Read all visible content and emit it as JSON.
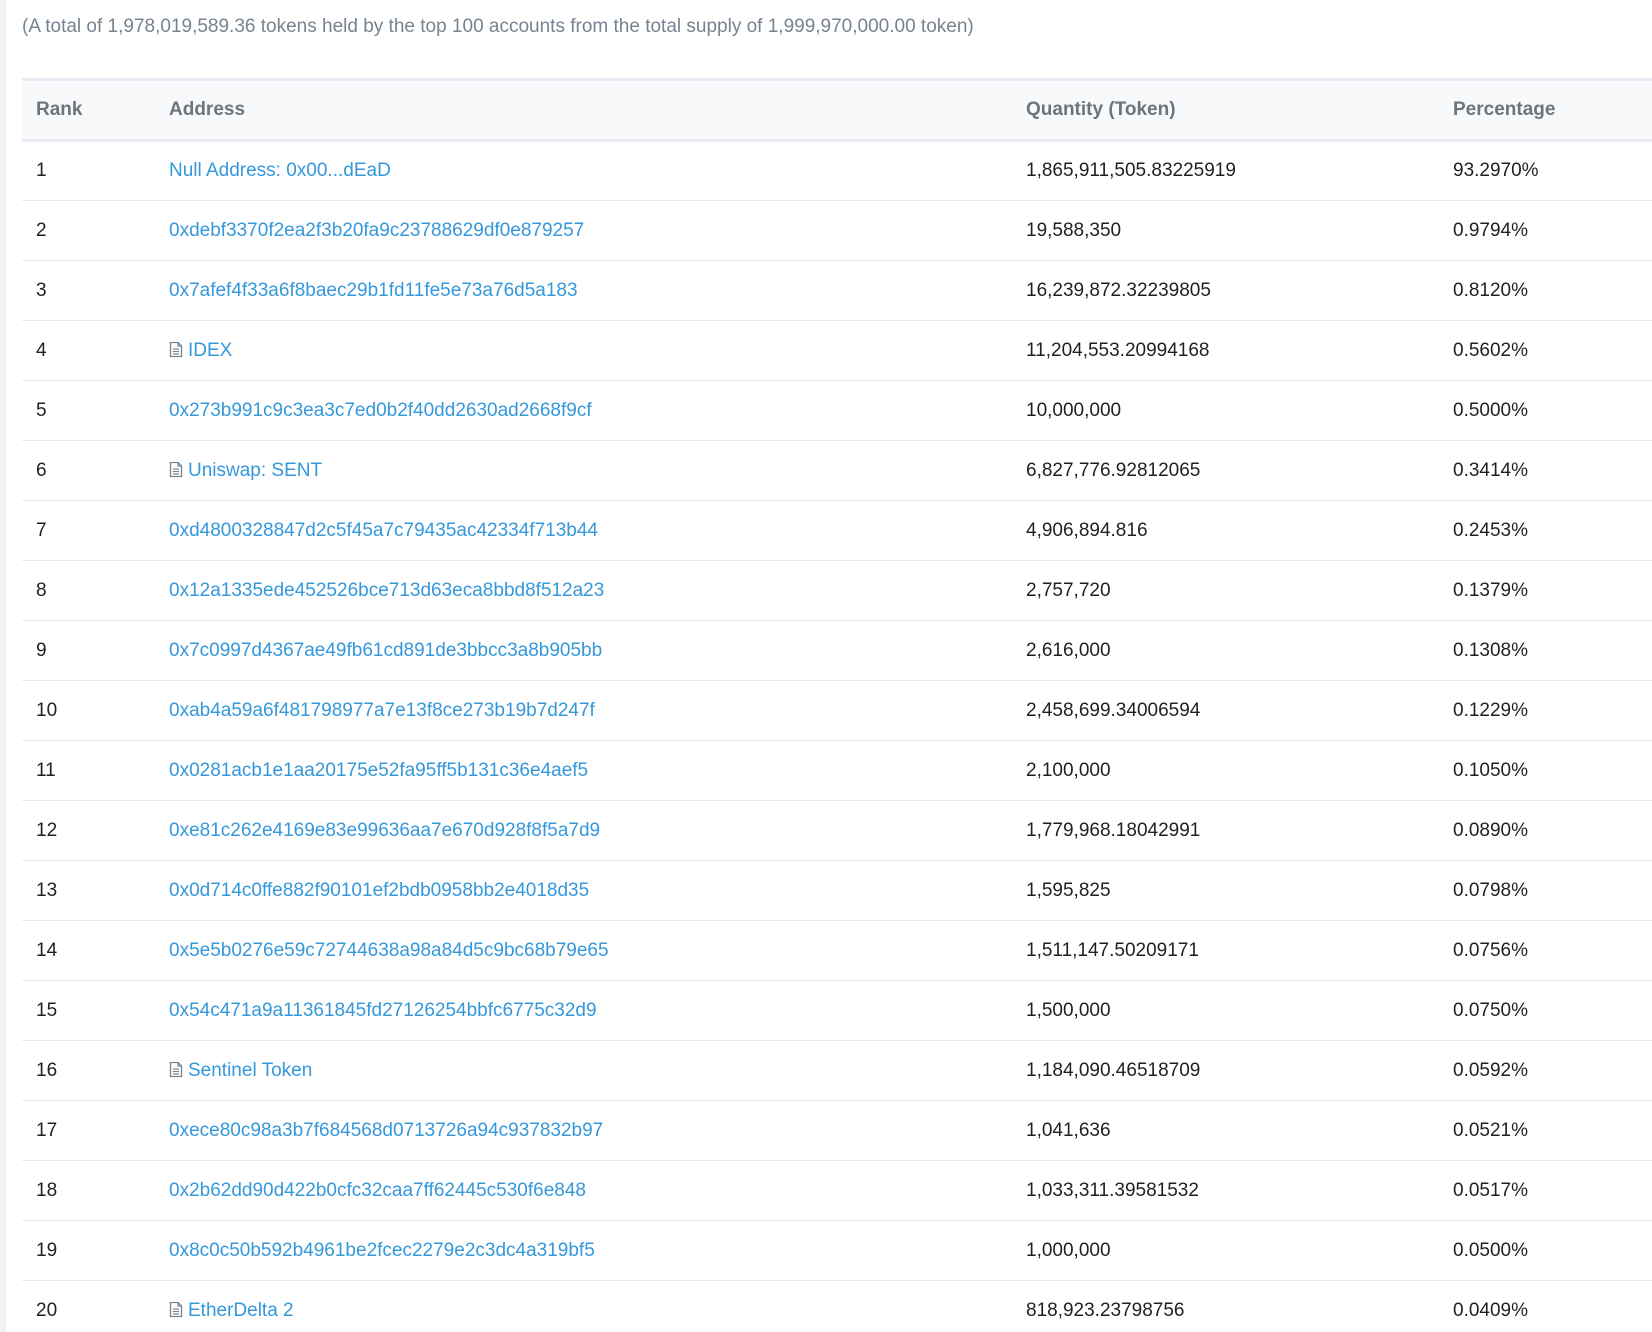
{
  "summary": "(A total of 1,978,019,589.36 tokens held by the top 100 accounts from the total supply of 1,999,970,000.00 token)",
  "table": {
    "headers": {
      "rank": "Rank",
      "address": "Address",
      "quantity": "Quantity (Token)",
      "percentage": "Percentage"
    },
    "rows": [
      {
        "rank": "1",
        "address": "Null Address: 0x00...dEaD",
        "contract": false,
        "quantity": "1,865,911,505.83225919",
        "percentage": "93.2970%"
      },
      {
        "rank": "2",
        "address": "0xdebf3370f2ea2f3b20fa9c23788629df0e879257",
        "contract": false,
        "quantity": "19,588,350",
        "percentage": "0.9794%"
      },
      {
        "rank": "3",
        "address": "0x7afef4f33a6f8baec29b1fd11fe5e73a76d5a183",
        "contract": false,
        "quantity": "16,239,872.32239805",
        "percentage": "0.8120%"
      },
      {
        "rank": "4",
        "address": "IDEX",
        "contract": true,
        "quantity": "11,204,553.20994168",
        "percentage": "0.5602%"
      },
      {
        "rank": "5",
        "address": "0x273b991c9c3ea3c7ed0b2f40dd2630ad2668f9cf",
        "contract": false,
        "quantity": "10,000,000",
        "percentage": "0.5000%"
      },
      {
        "rank": "6",
        "address": "Uniswap: SENT",
        "contract": true,
        "quantity": "6,827,776.92812065",
        "percentage": "0.3414%"
      },
      {
        "rank": "7",
        "address": "0xd4800328847d2c5f45a7c79435ac42334f713b44",
        "contract": false,
        "quantity": "4,906,894.816",
        "percentage": "0.2453%"
      },
      {
        "rank": "8",
        "address": "0x12a1335ede452526bce713d63eca8bbd8f512a23",
        "contract": false,
        "quantity": "2,757,720",
        "percentage": "0.1379%"
      },
      {
        "rank": "9",
        "address": "0x7c0997d4367ae49fb61cd891de3bbcc3a8b905bb",
        "contract": false,
        "quantity": "2,616,000",
        "percentage": "0.1308%"
      },
      {
        "rank": "10",
        "address": "0xab4a59a6f481798977a7e13f8ce273b19b7d247f",
        "contract": false,
        "quantity": "2,458,699.34006594",
        "percentage": "0.1229%"
      },
      {
        "rank": "11",
        "address": "0x0281acb1e1aa20175e52fa95ff5b131c36e4aef5",
        "contract": false,
        "quantity": "2,100,000",
        "percentage": "0.1050%"
      },
      {
        "rank": "12",
        "address": "0xe81c262e4169e83e99636aa7e670d928f8f5a7d9",
        "contract": false,
        "quantity": "1,779,968.18042991",
        "percentage": "0.0890%"
      },
      {
        "rank": "13",
        "address": "0x0d714c0ffe882f90101ef2bdb0958bb2e4018d35",
        "contract": false,
        "quantity": "1,595,825",
        "percentage": "0.0798%"
      },
      {
        "rank": "14",
        "address": "0x5e5b0276e59c72744638a98a84d5c9bc68b79e65",
        "contract": false,
        "quantity": "1,511,147.50209171",
        "percentage": "0.0756%"
      },
      {
        "rank": "15",
        "address": "0x54c471a9a11361845fd27126254bbfc6775c32d9",
        "contract": false,
        "quantity": "1,500,000",
        "percentage": "0.0750%"
      },
      {
        "rank": "16",
        "address": "Sentinel Token",
        "contract": true,
        "quantity": "1,184,090.46518709",
        "percentage": "0.0592%"
      },
      {
        "rank": "17",
        "address": "0xece80c98a3b7f684568d0713726a94c937832b97",
        "contract": false,
        "quantity": "1,041,636",
        "percentage": "0.0521%"
      },
      {
        "rank": "18",
        "address": "0x2b62dd90d422b0cfc32caa7ff62445c530f6e848",
        "contract": false,
        "quantity": "1,033,311.39581532",
        "percentage": "0.0517%"
      },
      {
        "rank": "19",
        "address": "0x8c0c50b592b4961be2fcec2279e2c3dc4a319bf5",
        "contract": false,
        "quantity": "1,000,000",
        "percentage": "0.0500%"
      },
      {
        "rank": "20",
        "address": "EtherDelta 2",
        "contract": true,
        "quantity": "818,923.23798756",
        "percentage": "0.0409%"
      }
    ]
  },
  "colors": {
    "link": "#3498db",
    "text": "#1e2022",
    "muted": "#77838f",
    "header_bg": "#f8f9fa",
    "border": "#e7eaf3"
  }
}
